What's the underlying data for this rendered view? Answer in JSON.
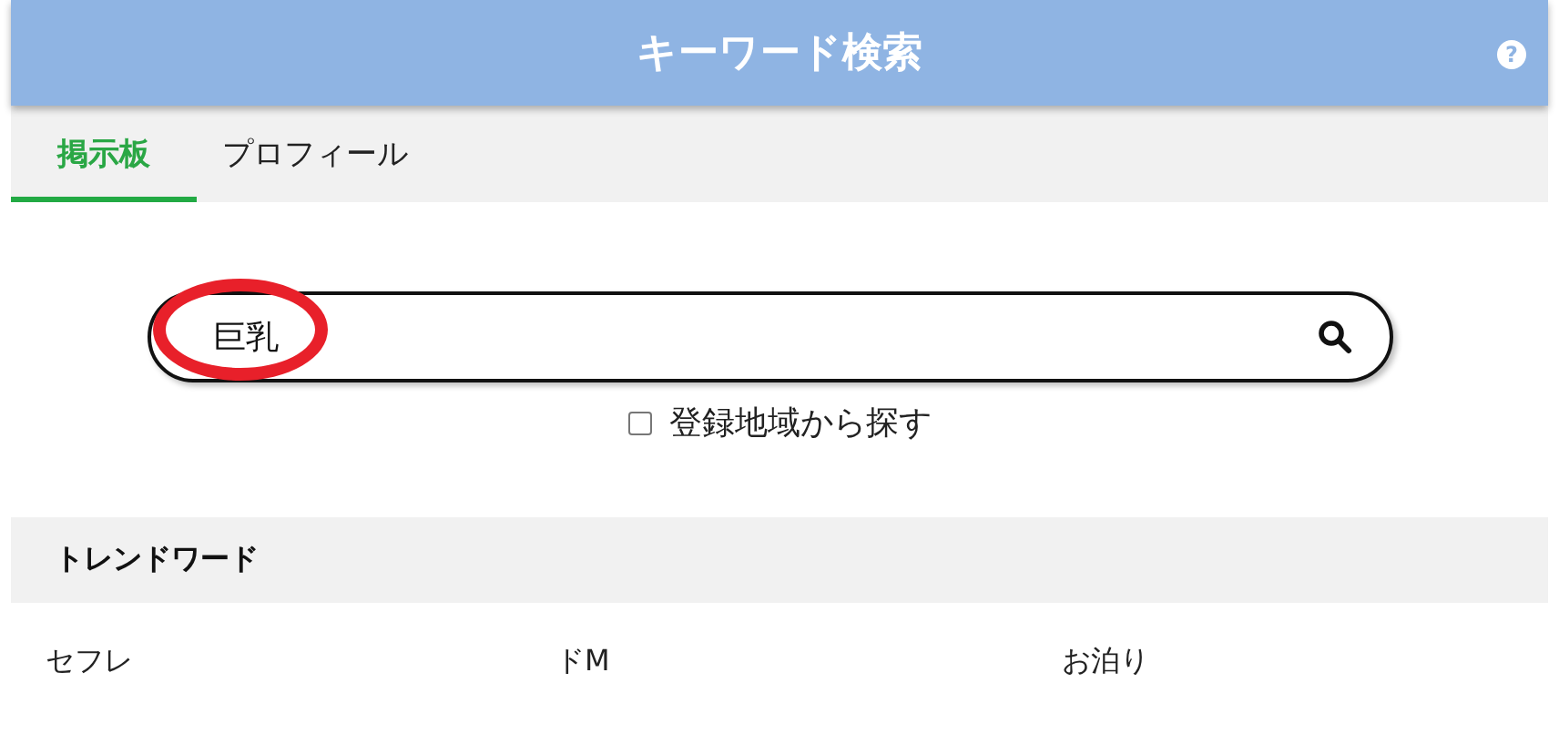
{
  "header": {
    "title": "キーワード検索",
    "help_icon": "?"
  },
  "tabs": [
    {
      "label": "掲示板",
      "selected": true
    },
    {
      "label": "プロフィール",
      "selected": false
    }
  ],
  "search": {
    "value": "巨乳",
    "highlighted": true
  },
  "region_checkbox": {
    "label": "登録地域から探す",
    "checked": false
  },
  "trend": {
    "title": "トレンドワード",
    "words": [
      "セフレ",
      "ドM",
      "お泊り"
    ]
  }
}
